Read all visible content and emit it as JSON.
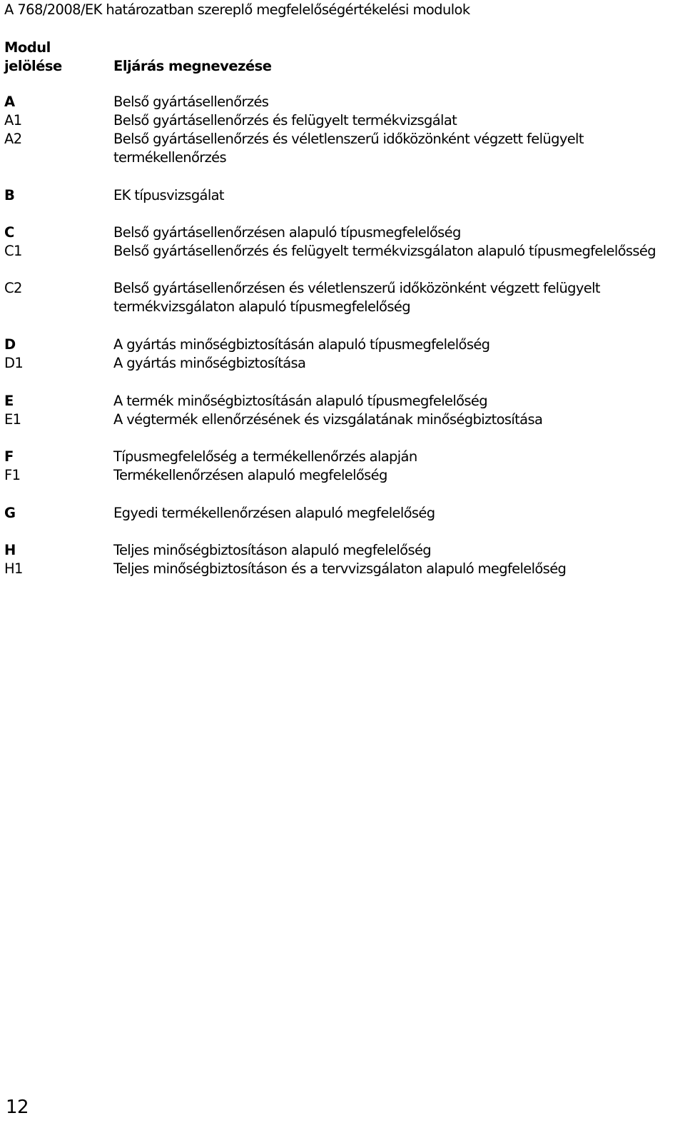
{
  "document": {
    "title": "A 768/2008/EK határozatban szereplő megfelelőségértékelési modulok",
    "header": {
      "code_label": "Modul\njelölése",
      "name_label": "Eljárás megnevezése"
    },
    "modules": [
      {
        "code": "A",
        "bold": true,
        "name": "Belső gyártásellenőrzés"
      },
      {
        "code": "A1",
        "bold": false,
        "name": "Belső gyártásellenőrzés és felügyelt termékvizsgálat"
      },
      {
        "code": "A2",
        "bold": false,
        "name": "Belső gyártásellenőrzés és véletlenszerű időközönként végzett felügyelt\ntermékellenőrzés"
      },
      {
        "code": "B",
        "bold": true,
        "name": "EK típusvizsgálat"
      },
      {
        "code": "C",
        "bold": true,
        "name": "Belső gyártásellenőrzésen alapuló típusmegfelelőség"
      },
      {
        "code": "C1",
        "bold": false,
        "name": "Belső gyártásellenőrzés és felügyelt termékvizsgálaton alapuló típusmegfelelősség"
      },
      {
        "code": "C2",
        "bold": false,
        "name": "Belső gyártásellenőrzésen és véletlenszerű időközönként végzett felügyelt\ntermékvizsgálaton alapuló típusmegfelelőség"
      },
      {
        "code": "D",
        "bold": true,
        "name": "A gyártás minőségbiztosításán alapuló típusmegfelelőség"
      },
      {
        "code": "D1",
        "bold": false,
        "name": "A gyártás minőségbiztosítása"
      },
      {
        "code": "E",
        "bold": true,
        "name": "A termék minőségbiztosításán alapuló típusmegfelelőség"
      },
      {
        "code": "E1",
        "bold": false,
        "name": "A végtermék ellenőrzésének és vizsgálatának minőségbiztosítása"
      },
      {
        "code": "F",
        "bold": true,
        "name": "Típusmegfelelőség a termékellenőrzés alapján"
      },
      {
        "code": "F1",
        "bold": false,
        "name": "Termékellenőrzésen alapuló megfelelőség"
      },
      {
        "code": "G",
        "bold": true,
        "name": "Egyedi termékellenőrzésen alapuló megfelelőség"
      },
      {
        "code": "H",
        "bold": true,
        "name": "Teljes minőségbiztosításon alapuló megfelelőség"
      },
      {
        "code": "H1",
        "bold": false,
        "name": "Teljes minőségbiztosításon és a tervvizsgálaton alapuló megfelelőség"
      }
    ],
    "page_number": "12"
  }
}
